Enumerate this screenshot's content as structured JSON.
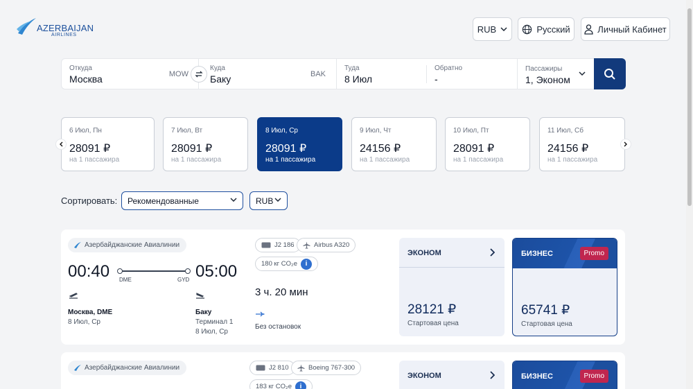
{
  "header": {
    "logo_line1": "AZERBAIJAN",
    "logo_line2": "AIRLINES",
    "currency_button": "RUB",
    "language_button": "Русский",
    "account_button": "Личный Кабинет"
  },
  "search": {
    "from_label": "Откуда",
    "from_value": "Москва",
    "from_code": "MOW",
    "to_label": "Куда",
    "to_value": "Баку",
    "to_code": "BAK",
    "depart_label": "Туда",
    "depart_value": "8 Июл",
    "return_label": "Обратно",
    "return_value": "-",
    "pax_label": "Пассажиры",
    "pax_value": "1, Эконом"
  },
  "dates": [
    {
      "date": "6 Июл, Пн",
      "price": "28091 ₽",
      "note": "на 1 пассажира"
    },
    {
      "date": "7 Июл, Вт",
      "price": "28091 ₽",
      "note": "на 1 пассажира"
    },
    {
      "date": "8 Июл, Ср",
      "price": "28091 ₽",
      "note": "на 1 пассажира"
    },
    {
      "date": "9 Июл, Чт",
      "price": "24156 ₽",
      "note": "на 1 пассажира"
    },
    {
      "date": "10 Июл, Пт",
      "price": "28091 ₽",
      "note": "на 1 пассажира"
    },
    {
      "date": "11 Июл, Сб",
      "price": "24156 ₽",
      "note": "на 1 пассажира"
    }
  ],
  "selected_date_index": 2,
  "sort": {
    "label": "Сортировать:",
    "value": "Рекомендованные",
    "currency": "RUB"
  },
  "flights": [
    {
      "airline": "Азербайджанские Авиалинии",
      "dep_time": "00:40",
      "arr_time": "05:00",
      "dep_code": "DME",
      "arr_code": "GYD",
      "dep_city": "Москва, DME",
      "dep_date": "8 Июл, Ср",
      "arr_city": "Баку",
      "arr_terminal": "Терминал 1",
      "arr_date": "8 Июл, Ср",
      "flight_no": "J2 186",
      "aircraft": "Airbus A320",
      "co2": "180 кг CO₂e",
      "duration": "3 ч. 20 мин",
      "stops": "Без остановок",
      "economy": {
        "title": "ЭКОНОМ",
        "price": "28121 ₽",
        "caption": "Стартовая цена"
      },
      "business": {
        "title": "БИЗНЕС",
        "badge": "Promo",
        "price": "65741 ₽",
        "caption": "Стартовая цена"
      }
    },
    {
      "airline": "Азербайджанские Авиалинии",
      "flight_no": "J2 810",
      "aircraft": "Boeing 767-300",
      "co2": "183 кг CO₂e",
      "economy": {
        "title": "ЭКОНОМ"
      },
      "business": {
        "title": "БИЗНЕС",
        "badge": "Promo"
      }
    }
  ],
  "colors": {
    "brand_dark": "#123a7c",
    "selected_date": "#0b3b89",
    "promo": "#c0264f"
  }
}
